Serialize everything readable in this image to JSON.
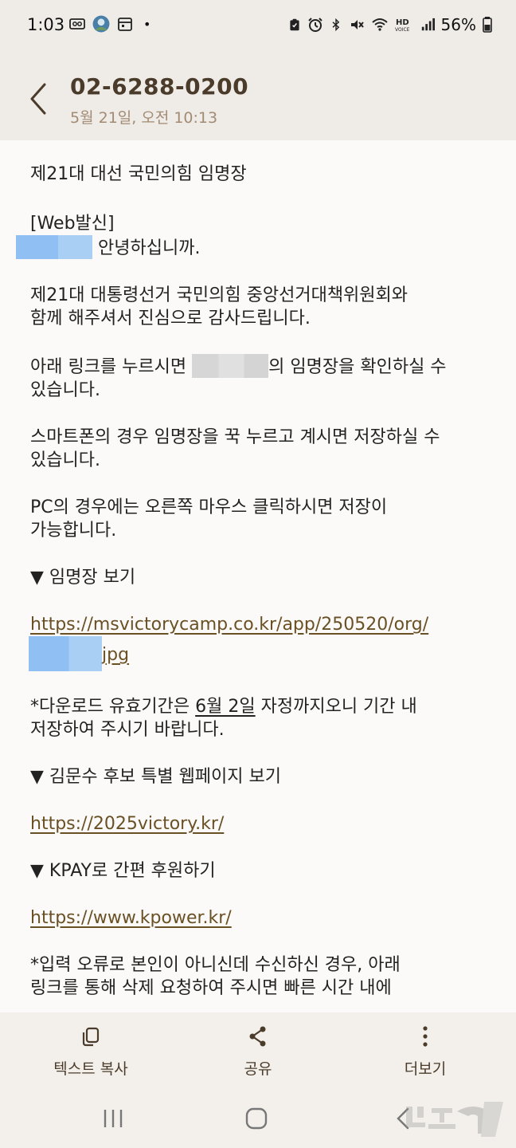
{
  "status_bar": {
    "time": "1:03",
    "battery": "56%",
    "dot": "•"
  },
  "header": {
    "sender": "02-6288-0200",
    "date": "5월 21일, 오전 10:13"
  },
  "message": {
    "title": "제21대 대선 국민의힘 임명장",
    "web_tag": "[Web발신]",
    "greeting": "안녕하십니까.",
    "thanks_line1": "제21대 대통령선거 국민의힘 중앙선거대책위원회와",
    "thanks_line2": "함께 해주셔서 진심으로 감사드립니다.",
    "link_info_pre": "아래 링크를 누르시면",
    "link_info_post": "의 임명장을 확인하실 수",
    "link_info_line2": "있습니다.",
    "smartphone_line1": "스마트폰의 경우 임명장을 꾹 누르고 계시면 저장하실 수",
    "smartphone_line2": "있습니다.",
    "pc_line1": "PC의 경우에는 오른쪽 마우스 클릭하시면 저장이",
    "pc_line2": "가능합니다.",
    "section1": "▼ 임명장 보기",
    "link1": "https://msvictorycamp.co.kr/app/250520/org/",
    "link1_suffix": "jpg",
    "expiry_pre": "*다운로드 유효기간은 ",
    "expiry_date": "6월 2일",
    "expiry_post": " 자정까지오니 기간 내",
    "expiry_line2": "저장하여 주시기 바랍니다.",
    "section2": "▼ 김문수 후보 특별 웹페이지 보기",
    "link2": "https://2025victory.kr/",
    "section3": "▼ KPAY로 간편 후원하기",
    "link3": "https://www.kpower.kr/",
    "error_line1": "*입력 오류로 본인이 아니신데 수신하신 경우, 아래",
    "error_line2": "링크를 통해 삭제 요청하여 주시면 빠른 시간 내에"
  },
  "bottom_actions": {
    "copy": "텍스트 복사",
    "share": "공유",
    "more": "더보기"
  },
  "colors": {
    "header_bg": "#efece8",
    "sender": "#4a3b2a",
    "date": "#a38b73",
    "link": "#6a5025",
    "content_bg": "#fbfaf8"
  }
}
